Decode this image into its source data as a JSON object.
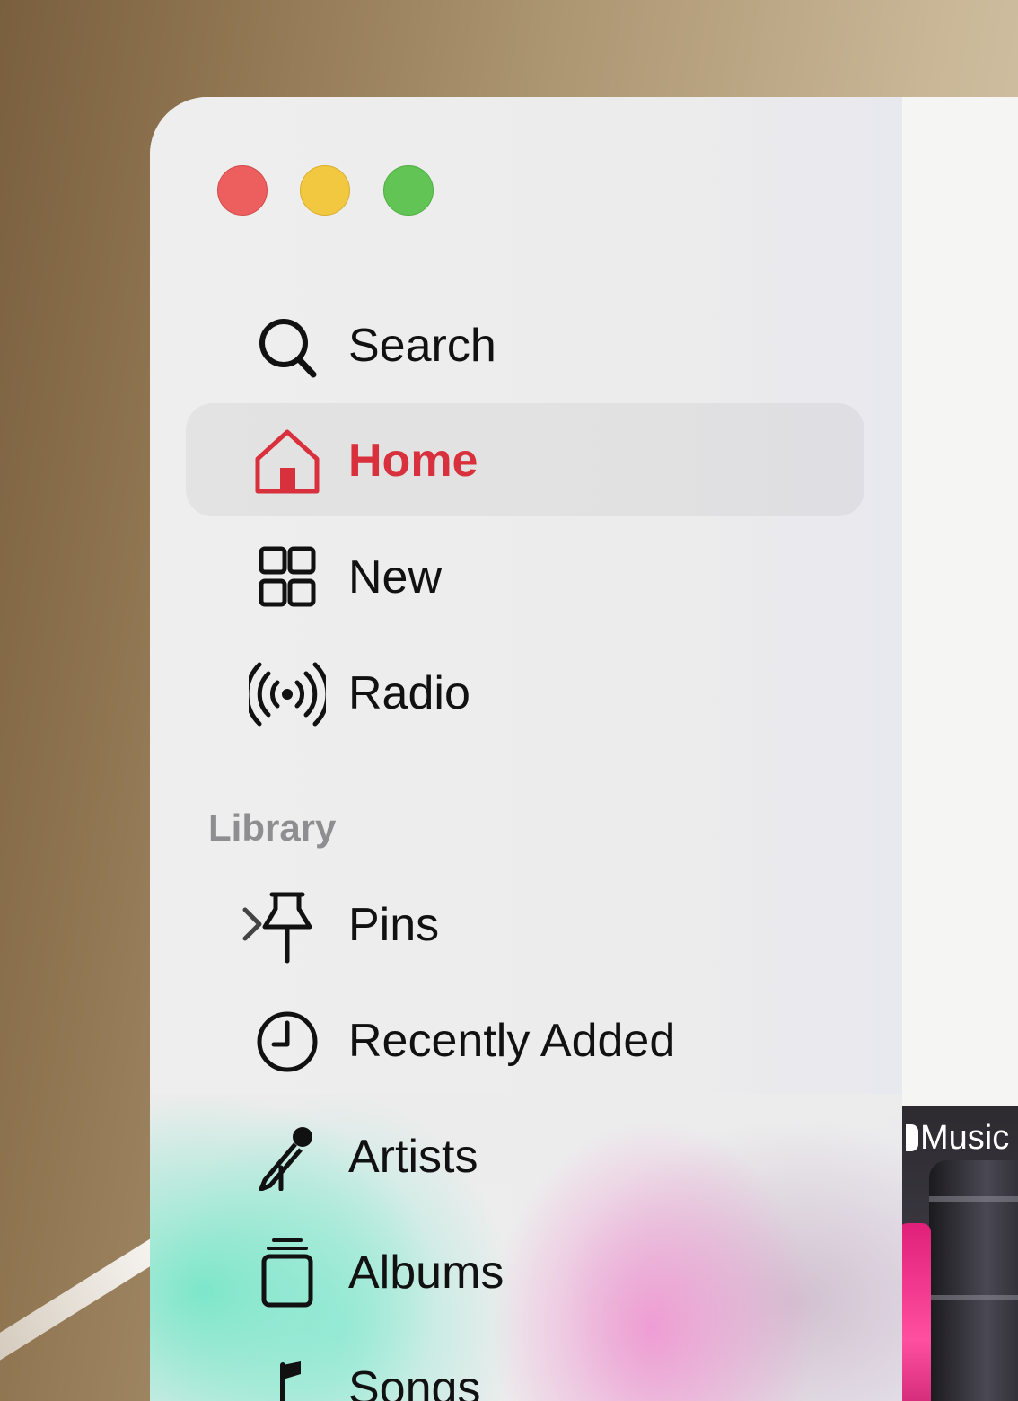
{
  "window": {
    "controls": [
      "close",
      "minimize",
      "maximize"
    ]
  },
  "sidebar": {
    "primary": [
      {
        "id": "search",
        "label": "Search",
        "icon": "search-icon",
        "selected": false
      },
      {
        "id": "home",
        "label": "Home",
        "icon": "house-icon",
        "selected": true
      },
      {
        "id": "new",
        "label": "New",
        "icon": "grid-icon",
        "selected": false
      },
      {
        "id": "radio",
        "label": "Radio",
        "icon": "broadcast-icon",
        "selected": false
      }
    ],
    "library_title": "Library",
    "library": [
      {
        "id": "pins",
        "label": "Pins",
        "icon": "pin-icon",
        "expandable": true
      },
      {
        "id": "recently-added",
        "label": "Recently Added",
        "icon": "clock-icon"
      },
      {
        "id": "artists",
        "label": "Artists",
        "icon": "microphone-icon"
      },
      {
        "id": "albums",
        "label": "Albums",
        "icon": "album-stack-icon"
      },
      {
        "id": "songs",
        "label": "Songs",
        "icon": "music-note-icon"
      }
    ]
  },
  "content": {
    "banner_label": "Music",
    "banner_logo": "apple-logo-icon"
  },
  "colors": {
    "accent": "#d8303d",
    "close": "#ec5f5e",
    "minimize": "#f2c840",
    "maximize": "#61c454"
  }
}
